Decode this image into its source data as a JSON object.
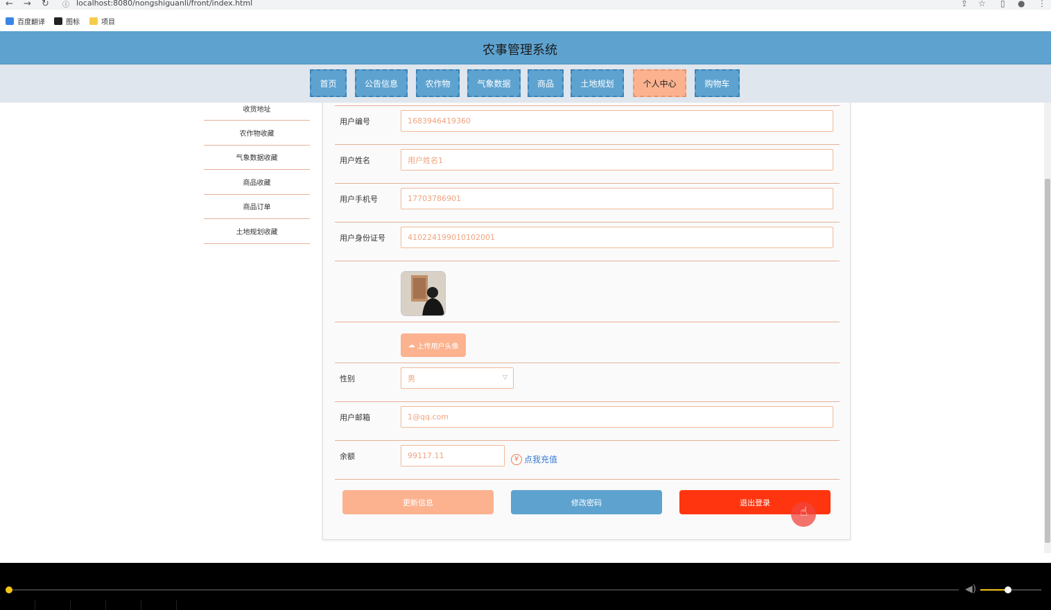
{
  "browser": {
    "url": "localhost:8080/nongshiguanli/front/index.html",
    "bookmarks": [
      {
        "label": "百度翻译",
        "icon": "translate-icon",
        "color": "#3a86e8"
      },
      {
        "label": "图标",
        "icon": "image-icon",
        "color": "#222222"
      },
      {
        "label": "项目",
        "icon": "folder-icon",
        "color": "#f5cc4a"
      }
    ]
  },
  "site": {
    "title": "农事管理系统",
    "nav": [
      "首页",
      "公告信息",
      "农作物",
      "气象数据",
      "商品",
      "土地规划",
      "个人中心",
      "购物车"
    ],
    "active_nav": "个人中心"
  },
  "sidebar": {
    "items": [
      "收货地址",
      "农作物收藏",
      "气象数据收藏",
      "商品收藏",
      "商品订单",
      "土地规划收藏"
    ]
  },
  "form": {
    "user_id": {
      "label": "用户编号",
      "value": "1683946419360"
    },
    "user_name": {
      "label": "用户姓名",
      "value": "用户姓名1"
    },
    "phone": {
      "label": "用户手机号",
      "value": "17703786901"
    },
    "id_card": {
      "label": "用户身份证号",
      "value": "410224199010102001"
    },
    "upload_label": "上传用户头像",
    "gender": {
      "label": "性别",
      "value": "男"
    },
    "email": {
      "label": "用户邮箱",
      "value": "1@qq.com"
    },
    "balance": {
      "label": "余额",
      "value": "99117.11",
      "recharge": "点我充值",
      "currency_symbol": "¥"
    }
  },
  "buttons": {
    "update": "更新信息",
    "change_password": "修改密码",
    "logout": "退出登录"
  },
  "player": {
    "progress": 0.0,
    "volume": 0.45
  }
}
